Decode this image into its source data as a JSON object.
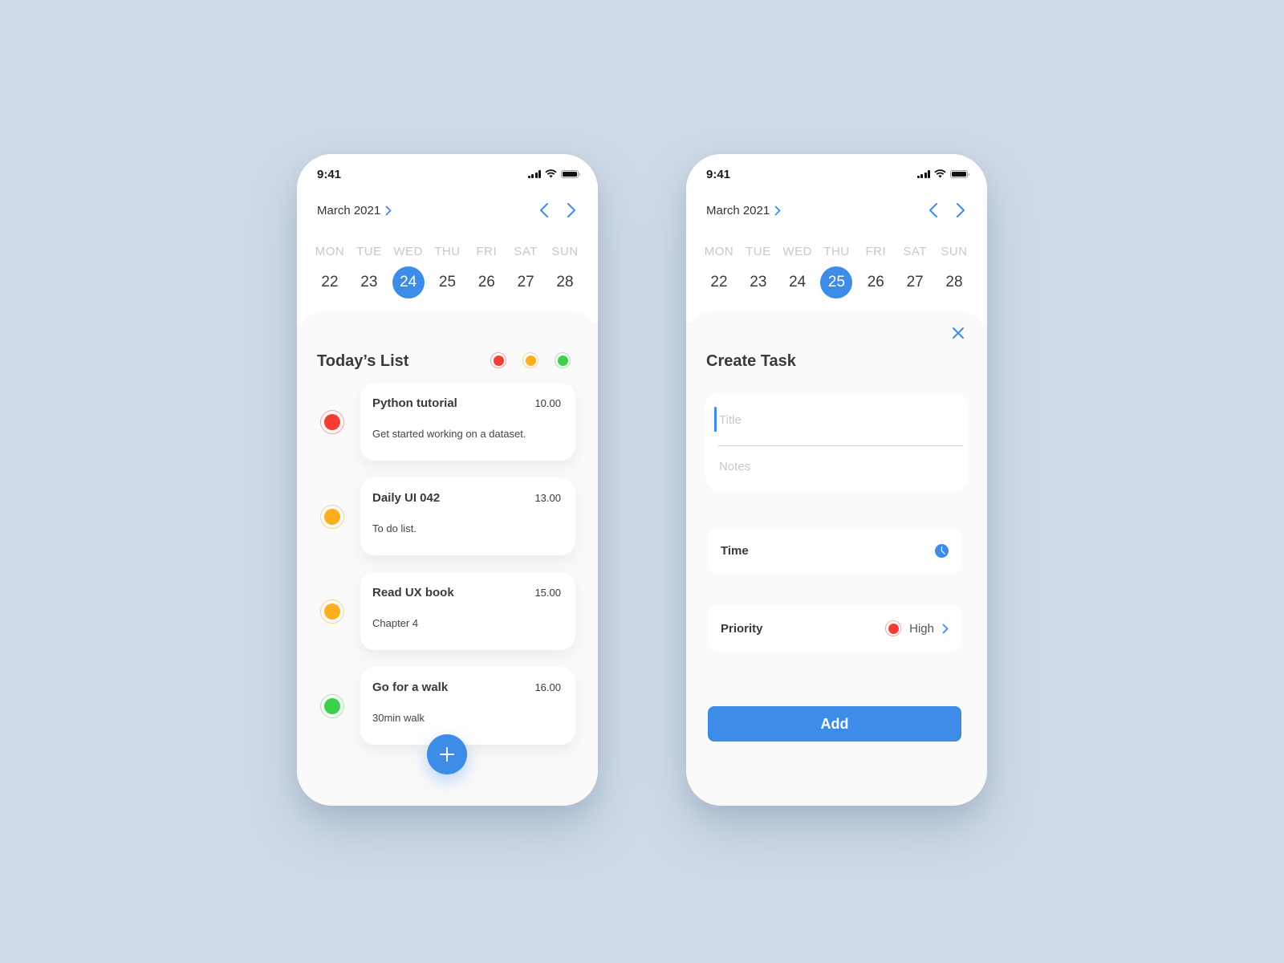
{
  "colors": {
    "accent": "#3d8ce8",
    "priority_high": "#f43c33",
    "priority_medium": "#fdae1d",
    "priority_low": "#3bd14a",
    "background": "#cfdbe7"
  },
  "screens": [
    {
      "status": {
        "time": "9:41"
      },
      "calendar": {
        "month_label": "March 2021",
        "prev_icon": "chevron-left-icon",
        "next_icon": "chevron-right-icon",
        "days": [
          {
            "dow": "MON",
            "num": "22"
          },
          {
            "dow": "TUE",
            "num": "23"
          },
          {
            "dow": "WED",
            "num": "24",
            "selected": true
          },
          {
            "dow": "THU",
            "num": "25"
          },
          {
            "dow": "FRI",
            "num": "26"
          },
          {
            "dow": "SAT",
            "num": "27"
          },
          {
            "dow": "SUN",
            "num": "28"
          }
        ]
      },
      "list": {
        "title": "Today’s List",
        "filters": [
          "high",
          "medium",
          "low"
        ],
        "tasks": [
          {
            "title": "Python tutorial",
            "time": "10.00",
            "note": "Get started working on a dataset.",
            "priority": "high"
          },
          {
            "title": "Daily UI 042",
            "time": "13.00",
            "note": "To do list.",
            "priority": "medium"
          },
          {
            "title": "Read UX book",
            "time": "15.00",
            "note": "Chapter 4",
            "priority": "medium"
          },
          {
            "title": "Go for a walk",
            "time": "16.00",
            "note": "30min walk",
            "priority": "low"
          }
        ],
        "fab_icon": "plus-icon"
      }
    },
    {
      "status": {
        "time": "9:41"
      },
      "calendar": {
        "month_label": "March 2021",
        "prev_icon": "chevron-left-icon",
        "next_icon": "chevron-right-icon",
        "days": [
          {
            "dow": "MON",
            "num": "22"
          },
          {
            "dow": "TUE",
            "num": "23"
          },
          {
            "dow": "WED",
            "num": "24"
          },
          {
            "dow": "THU",
            "num": "25",
            "selected": true
          },
          {
            "dow": "FRI",
            "num": "26"
          },
          {
            "dow": "SAT",
            "num": "27"
          },
          {
            "dow": "SUN",
            "num": "28"
          }
        ]
      },
      "form": {
        "title": "Create Task",
        "title_placeholder": "Title",
        "title_value": "",
        "notes_placeholder": "Notes",
        "notes_value": "",
        "time_label": "Time",
        "priority_label": "Priority",
        "priority_value": "High",
        "add_label": "Add"
      }
    }
  ]
}
